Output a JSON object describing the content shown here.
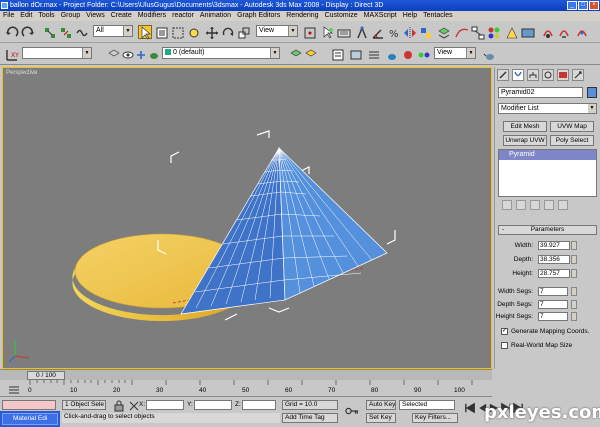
{
  "title_bar": {
    "text": "ballon dOr.max    - Project Folder: C:\\Users\\UlusGugus\\Documents\\3dsmax    - Autodesk 3ds Max 2008    - Display : Direct 3D",
    "minimize": "_",
    "maximize": "□",
    "close": "×"
  },
  "menu": [
    "File",
    "Edit",
    "Tools",
    "Group",
    "Views",
    "Create",
    "Modifiers",
    "reactor",
    "Animation",
    "Graph Editors",
    "Rendering",
    "Customize",
    "MAXScript",
    "Help",
    "Tentacles"
  ],
  "toolbar": {
    "selection_filter": "All",
    "reference_coord": "View",
    "named_selection": "",
    "layer": "0 (default)",
    "render_view": "View"
  },
  "viewport": {
    "label": "Perspective"
  },
  "command_panel": {
    "object_name": "Pyramid02",
    "object_color": "#5a8ed8",
    "modifier_list": "Modifier List",
    "buttons": [
      "Edit Mesh",
      "UVW Map",
      "Unwrap UVW",
      "Poly Select"
    ],
    "stack_item": "Pyramid",
    "rollout_title": "Parameters",
    "rollout_toggle": "-",
    "params": [
      {
        "label": "Width:",
        "value": "39.927"
      },
      {
        "label": "Depth:",
        "value": "38.356"
      },
      {
        "label": "Height:",
        "value": "28.757"
      }
    ],
    "segs": [
      {
        "label": "Width Segs:",
        "value": "7"
      },
      {
        "label": "Depth Segs:",
        "value": "7"
      },
      {
        "label": "Height Segs:",
        "value": "7"
      }
    ],
    "generate_mapping": {
      "label": "Generate Mapping Coords.",
      "checked": true,
      "mark": "✓"
    },
    "real_world": {
      "label": "Real-World Map Size",
      "checked": false
    }
  },
  "time_slider": {
    "position": "0 / 100",
    "ticks": [
      "0",
      "10",
      "20",
      "30",
      "40",
      "50",
      "60",
      "70",
      "80",
      "90",
      "100"
    ]
  },
  "status": {
    "selected": "1 Object Sele",
    "prompt": "Click-and-drag to select objects",
    "x_label": "X:",
    "y_label": "Y:",
    "z_label": "Z:",
    "grid": "Grid = 10.0",
    "auto_key": "Auto Key",
    "auto_key_mode": "Selected",
    "set_key": "Set Key",
    "key_filters": "Key Filters...",
    "add_time_tag": "Add Time Tag",
    "taskbar_item": "Material Edi"
  },
  "watermark": "pxleyes.com",
  "colors": {
    "viewport_bg": "#7d7d7d",
    "pyramid": "#4a7fd0",
    "coin": "#f0c040",
    "stack_highlight": "#7f86c8",
    "title_bar": "#0a3fc0"
  }
}
